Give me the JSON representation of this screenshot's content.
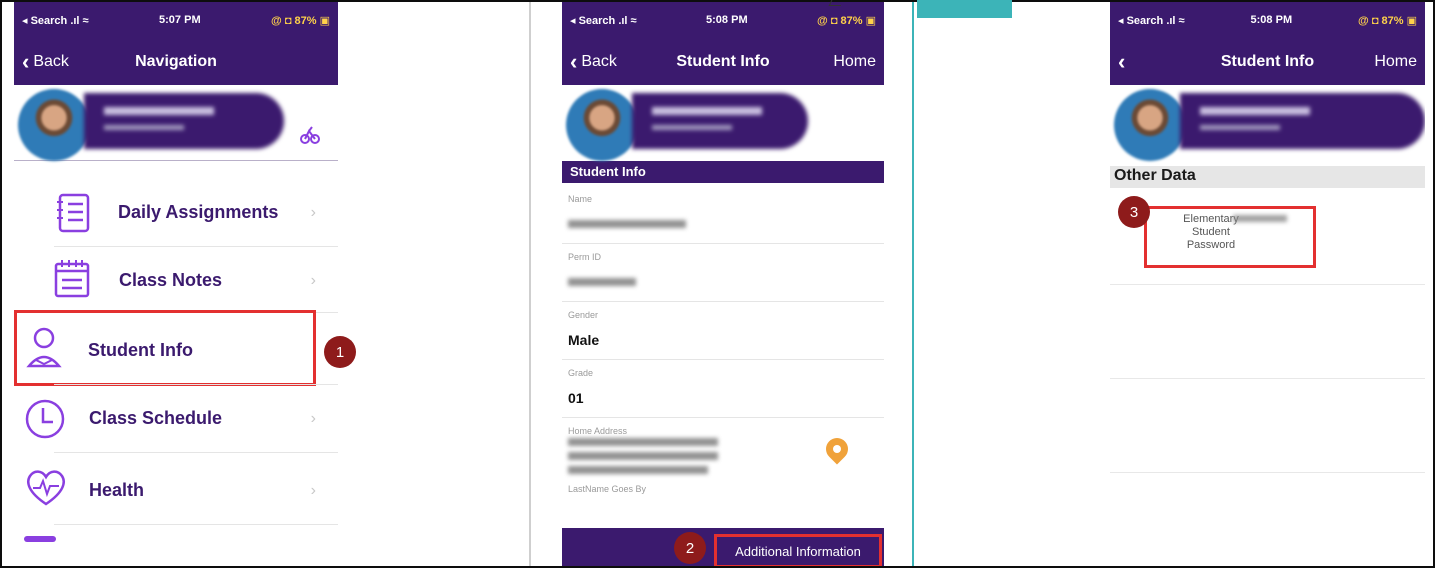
{
  "panel1": {
    "status": {
      "left": "◂ Search .ıl ≈",
      "time": "5:07 PM",
      "right": "@ ◘ 87% ▣"
    },
    "nav": {
      "back": "Back",
      "title": "Navigation"
    },
    "menu": [
      {
        "label": "Daily Assignments",
        "icon": "assignment-list-icon"
      },
      {
        "label": "Class Notes",
        "icon": "notes-icon"
      },
      {
        "label": "Student Info",
        "icon": "student-icon"
      },
      {
        "label": "Class Schedule",
        "icon": "clock-icon"
      },
      {
        "label": "Health",
        "icon": "heart-icon"
      }
    ]
  },
  "panel2": {
    "status": {
      "left": "◂ Search .ıl ≈",
      "time": "5:08 PM",
      "right": "@ ◘ 87% ▣"
    },
    "nav": {
      "back": "Back",
      "title": "Student Info",
      "home": "Home"
    },
    "section_title": "Student Info",
    "fields": {
      "name_label": "Name",
      "perm_label": "Perm ID",
      "gender_label": "Gender",
      "gender_value": "Male",
      "grade_label": "Grade",
      "grade_value": "01",
      "address_label": "Home Address",
      "lastname_label": "LastName Goes By"
    },
    "additional_button": "Additional Information"
  },
  "panel3": {
    "status": {
      "left": "◂ Search .ıl ≈",
      "time": "5:08 PM",
      "right": "@ ◘ 87% ▣"
    },
    "nav": {
      "title": "Student Info",
      "home": "Home"
    },
    "section_title": "Other Data",
    "data_lines": [
      "Elementary",
      "Student",
      "Password"
    ]
  },
  "callouts": [
    "1",
    "2",
    "3"
  ],
  "colors": {
    "brand": "#3b1a6e",
    "accent": "#8a3fe0",
    "highlight": "#e33030",
    "callout": "#8e1b1b"
  }
}
